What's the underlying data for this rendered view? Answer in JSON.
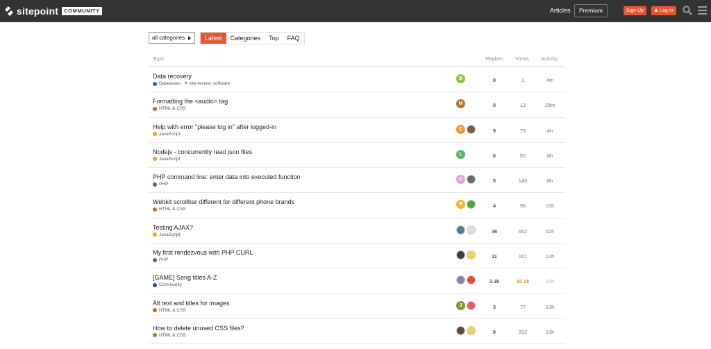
{
  "header": {
    "logo_text": "sitepoint",
    "logo_badge": "COMMUNITY",
    "nav_articles": "Articles",
    "nav_premium": "Premium",
    "signup_label": "Sign Up",
    "login_label": "Log In",
    "accent": "#e45735"
  },
  "filters": {
    "category_select": "all categories",
    "tabs": [
      "Latest",
      "Categories",
      "Top",
      "FAQ"
    ],
    "active_tab": "Latest"
  },
  "table": {
    "columns": [
      "Topic",
      "Replies",
      "Views",
      "Activity"
    ],
    "rows": [
      {
        "title": "Data recovery",
        "category": "Databases",
        "category_color": "#0e76bd",
        "tags": "site-review, software",
        "posters": [
          {
            "letter": "B",
            "color": "#8ec53d"
          }
        ],
        "replies": "0",
        "views": "1",
        "activity": "4m"
      },
      {
        "title": "Formatting the <audio> tag",
        "category": "HTML & CSS",
        "category_color": "#bf6c25",
        "tags": "",
        "posters": [
          {
            "letter": "M",
            "color": "#b2762e"
          }
        ],
        "replies": "0",
        "views": "13",
        "activity": "28m"
      },
      {
        "title": "Help with error \"please log in\" after logged-in",
        "category": "JavaScript",
        "category_color": "#e2ad15",
        "tags": "",
        "posters": [
          {
            "letter": "C",
            "color": "#e89b32"
          },
          {
            "letter": "",
            "color": "#7a5a46",
            "img": true
          }
        ],
        "replies": "9",
        "views": "79",
        "activity": "4h"
      },
      {
        "title": "Nodejs - concurrently read json files",
        "category": "JavaScript",
        "category_color": "#e2ad15",
        "tags": "",
        "posters": [
          {
            "letter": "L",
            "color": "#5fb760"
          }
        ],
        "replies": "0",
        "views": "50",
        "activity": "6h"
      },
      {
        "title": "PHP command line: enter data into executed function",
        "category": "PHP",
        "category_color": "#5b5f97",
        "tags": "",
        "posters": [
          {
            "letter": "D",
            "color": "#e2a3cf"
          },
          {
            "letter": "",
            "color": "#6a6a6a",
            "img": true
          }
        ],
        "replies": "5",
        "views": "145",
        "activity": "8h"
      },
      {
        "title": "Webkit scrollbar different for different phone brands",
        "category": "HTML & CSS",
        "category_color": "#bf6c25",
        "tags": "",
        "posters": [
          {
            "letter": "R",
            "color": "#f0b428"
          },
          {
            "letter": "",
            "color": "#49a639",
            "img": true
          }
        ],
        "replies": "4",
        "views": "96",
        "activity": "10h"
      },
      {
        "title": "Testing AJAX?",
        "category": "JavaScript",
        "category_color": "#e2ad15",
        "tags": "",
        "posters": [
          {
            "letter": "",
            "color": "#4d7f94",
            "img": true
          },
          {
            "letter": "",
            "color": "#d8dfe6",
            "img": true
          }
        ],
        "replies": "36",
        "views": "662",
        "activity": "10h"
      },
      {
        "title": "My first rendezvous with PHP CURL",
        "category": "PHP",
        "category_color": "#5b5f97",
        "tags": "",
        "posters": [
          {
            "letter": "",
            "color": "#3d3d3d",
            "img": true
          },
          {
            "letter": "",
            "color": "#f3d25a",
            "img": true
          }
        ],
        "replies": "11",
        "views": "161",
        "activity": "12h"
      },
      {
        "title": "[GAME] Song titles A-Z",
        "category": "Community",
        "category_color": "#235789",
        "tags": "",
        "posters": [
          {
            "letter": "",
            "color": "#7c8a99",
            "img": true
          },
          {
            "letter": "",
            "color": "#e24d3f",
            "img": true
          }
        ],
        "replies": "3.3k",
        "views": "35.1k",
        "views_hot": true,
        "activity": "12h",
        "activity_dim": true
      },
      {
        "title": "Alt text and titles for images",
        "category": "HTML & CSS",
        "category_color": "#bf6c25",
        "tags": "",
        "posters": [
          {
            "letter": "J",
            "color": "#7a9c2b"
          },
          {
            "letter": "",
            "color": "#e95a5a",
            "img": true
          }
        ],
        "replies": "3",
        "views": "77",
        "activity": "13h"
      },
      {
        "title": "How to delete unused CSS files?",
        "category": "HTML & CSS",
        "category_color": "#bf6c25",
        "tags": "",
        "posters": [
          {
            "letter": "",
            "color": "#5b4b3c",
            "img": true
          },
          {
            "letter": "",
            "color": "#f3d25a",
            "img": true
          }
        ],
        "replies": "9",
        "views": "202",
        "activity": "13h"
      }
    ]
  }
}
